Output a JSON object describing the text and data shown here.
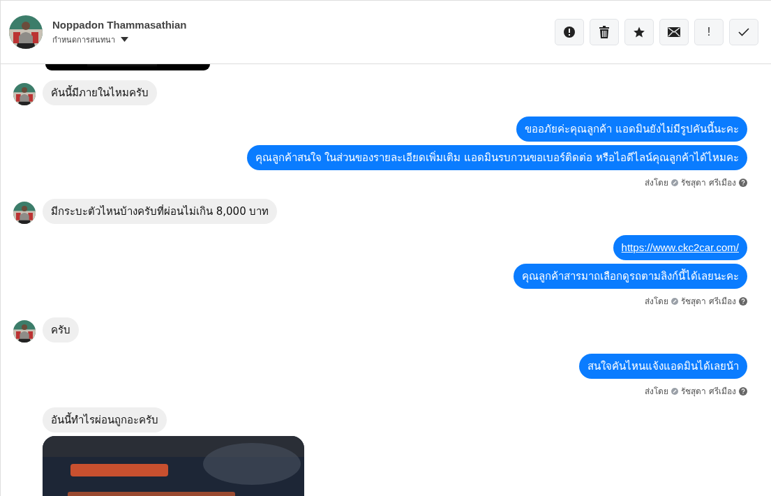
{
  "header": {
    "name": "Noppadon Thammasathian",
    "subtitle": "กำหนดการสนทนา"
  },
  "toolbar": {
    "exclamation_label": "!"
  },
  "entries": [
    {
      "kind": "image_tail"
    },
    {
      "kind": "incoming",
      "avatar": true,
      "bubbles": [
        {
          "kind": "text",
          "text": "คันนี้มีภายในไหมครับ"
        }
      ]
    },
    {
      "kind": "outgoing",
      "bubbles": [
        {
          "kind": "text",
          "text": "ขออภัยค่ะคุณลูกค้า แอดมินยังไม่มีรูปคันนี้นะคะ"
        },
        {
          "kind": "text",
          "text": "คุณลูกค้าสนใจ ในส่วนของรายละเอียดเพิ่มเติม แอดมินรบกวนขอเบอร์ติดต่อ หรือไอดีไลน์คุณลูกค้าได้ไหมคะ"
        }
      ],
      "sent_by": {
        "label": "ส่งโดย",
        "agent": "รัชสุดา ศรีเมือง"
      }
    },
    {
      "kind": "incoming",
      "avatar": true,
      "bubbles": [
        {
          "kind": "text",
          "text": "มีกระบะตัวไหนบ้างครับที่ผ่อนไม่เกิน 8,000 บาท"
        }
      ]
    },
    {
      "kind": "outgoing",
      "bubbles": [
        {
          "kind": "link",
          "text": "https://www.ckc2car.com/"
        },
        {
          "kind": "text",
          "text": "คุณลูกค้าสารมาถเลือกดูรถตามลิงก์นี้ได้เลยนะคะ"
        }
      ],
      "sent_by": {
        "label": "ส่งโดย",
        "agent": "รัชสุดา ศรีเมือง"
      }
    },
    {
      "kind": "incoming",
      "avatar": true,
      "bubbles": [
        {
          "kind": "text",
          "text": "ครับ"
        }
      ]
    },
    {
      "kind": "outgoing",
      "bubbles": [
        {
          "kind": "text",
          "text": "สนใจคันไหนแจ้งแอดมินได้เลยน้า"
        }
      ],
      "sent_by": {
        "label": "ส่งโดย",
        "agent": "รัชสุดา ศรีเมือง"
      }
    },
    {
      "kind": "incoming",
      "avatar": false,
      "bubbles": [
        {
          "kind": "text",
          "text": "อันนี้ทำไรผ่อนถูกอะครับ"
        },
        {
          "kind": "picture"
        }
      ]
    }
  ]
}
